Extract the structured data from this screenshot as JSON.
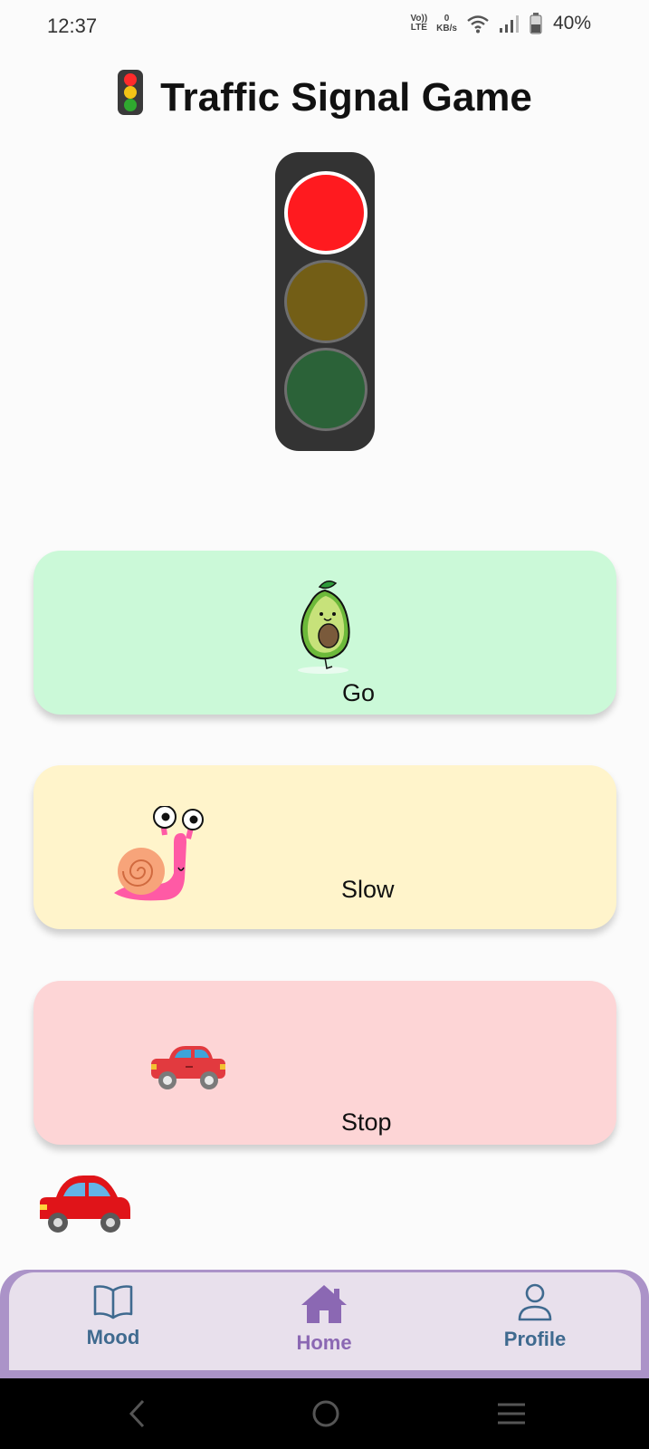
{
  "status_bar": {
    "time": "12:37",
    "volte_top": "Vo))",
    "volte_bottom": "LTE",
    "net_speed_value": "0",
    "net_speed_unit": "KB/s",
    "battery_percent": "40%"
  },
  "header": {
    "title": "Traffic Signal Game",
    "title_icon": "traffic-light-icon"
  },
  "traffic_light": {
    "active_lamp": "red",
    "colors": {
      "red_on": "#ff1a1f",
      "yellow_off": "#735e16",
      "green_off": "#2b6238",
      "housing": "#333333"
    }
  },
  "options": [
    {
      "id": "go",
      "label": "Go",
      "icon": "avocado-icon",
      "background": "#cbf9d8"
    },
    {
      "id": "slow",
      "label": "Slow",
      "icon": "snail-icon",
      "background": "#fff4cb"
    },
    {
      "id": "stop",
      "label": "Stop",
      "icon": "car-icon",
      "background": "#fdd5d6"
    }
  ],
  "floating_car": {
    "icon": "red-car-icon"
  },
  "bottom_nav": {
    "items": [
      {
        "label": "Mood",
        "icon": "open-book-icon",
        "active": false
      },
      {
        "label": "Home",
        "icon": "home-icon",
        "active": true
      },
      {
        "label": "Profile",
        "icon": "person-icon",
        "active": false
      }
    ],
    "active_color": "#8b68b3",
    "inactive_color": "#3f6a8f"
  },
  "system_nav": {
    "buttons": [
      "back-icon",
      "home-circle-icon",
      "recents-icon"
    ]
  }
}
